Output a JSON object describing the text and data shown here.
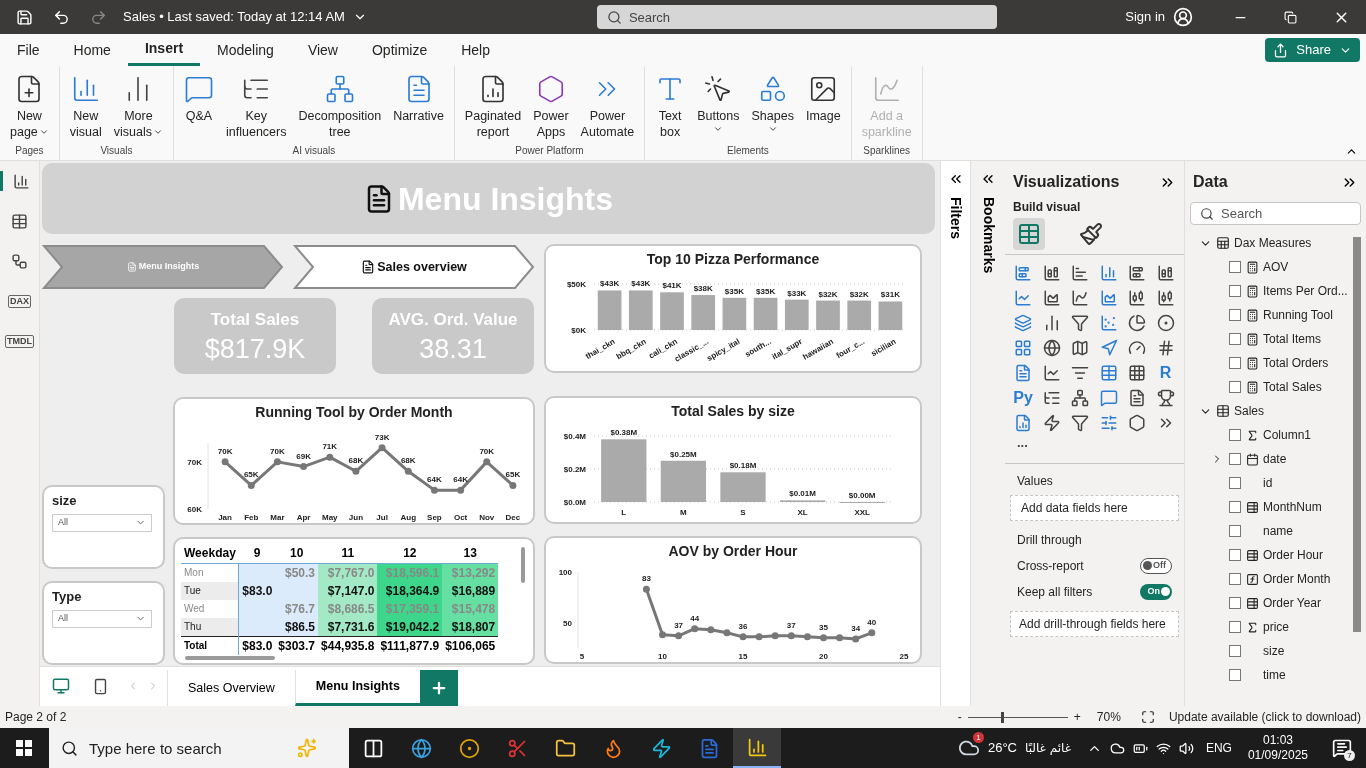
{
  "title_bar": {
    "document": "Sales",
    "separator": "•",
    "saved": "Last saved: Today at 12:14 AM",
    "search_placeholder": "Search",
    "sign_in": "Sign in"
  },
  "menu_tabs": [
    {
      "label": "File",
      "selected": false
    },
    {
      "label": "Home",
      "selected": false
    },
    {
      "label": "Insert",
      "selected": true
    },
    {
      "label": "Modeling",
      "selected": false
    },
    {
      "label": "View",
      "selected": false
    },
    {
      "label": "Optimize",
      "selected": false
    },
    {
      "label": "Help",
      "selected": false
    }
  ],
  "share": "Share",
  "ribbon_groups": [
    {
      "label": "Pages",
      "items": [
        {
          "kind": "new-page",
          "lines": [
            "New",
            "page"
          ],
          "dropdown": true,
          "disabled": false
        }
      ]
    },
    {
      "label": "Visuals",
      "items": [
        {
          "kind": "new-visual",
          "lines": [
            "New",
            "visual"
          ],
          "dropdown": false,
          "disabled": false
        },
        {
          "kind": "more-visuals",
          "lines": [
            "More",
            "visuals"
          ],
          "dropdown": true,
          "disabled": false
        }
      ]
    },
    {
      "label": "AI visuals",
      "items": [
        {
          "kind": "qa",
          "lines": [
            "Q&A"
          ],
          "dropdown": false,
          "disabled": false
        },
        {
          "kind": "key-influencers",
          "lines": [
            "Key",
            "influencers"
          ],
          "dropdown": false,
          "disabled": false
        },
        {
          "kind": "decomposition",
          "lines": [
            "Decomposition",
            "tree"
          ],
          "dropdown": false,
          "disabled": false
        },
        {
          "kind": "narrative",
          "lines": [
            "Narrative"
          ],
          "dropdown": false,
          "disabled": false
        }
      ]
    },
    {
      "label": "Power Platform",
      "items": [
        {
          "kind": "paginated",
          "lines": [
            "Paginated",
            "report"
          ],
          "dropdown": false,
          "disabled": false
        },
        {
          "kind": "power-apps",
          "lines": [
            "Power",
            "Apps"
          ],
          "dropdown": false,
          "disabled": false
        },
        {
          "kind": "power-automate",
          "lines": [
            "Power",
            "Automate"
          ],
          "dropdown": false,
          "disabled": false
        }
      ]
    },
    {
      "label": "Elements",
      "items": [
        {
          "kind": "text-box",
          "lines": [
            "Text",
            "box"
          ],
          "dropdown": false,
          "disabled": false
        },
        {
          "kind": "buttons",
          "lines": [
            "Buttons"
          ],
          "dropdown": true,
          "disabled": false
        },
        {
          "kind": "shapes",
          "lines": [
            "Shapes"
          ],
          "dropdown": true,
          "disabled": false
        },
        {
          "kind": "image",
          "lines": [
            "Image"
          ],
          "dropdown": false,
          "disabled": false
        }
      ]
    },
    {
      "label": "Sparklines",
      "items": [
        {
          "kind": "sparkline",
          "lines": [
            "Add a",
            "sparkline"
          ],
          "dropdown": false,
          "disabled": true
        }
      ]
    }
  ],
  "left_nav": [
    {
      "kind": "report",
      "selected": true
    },
    {
      "kind": "table",
      "selected": false
    },
    {
      "kind": "model",
      "selected": false
    },
    {
      "kind": "dax",
      "label": "DAX",
      "selected": false
    },
    {
      "kind": "tmdl",
      "label": "TMDL",
      "selected": false
    }
  ],
  "report": {
    "heading": "Menu Insights",
    "nav_buttons": [
      {
        "label": "Menu Insights",
        "selected": true
      },
      {
        "label": "Sales overview",
        "selected": false
      }
    ],
    "kpis": [
      {
        "label": "Total Sales",
        "value": "$817.9K"
      },
      {
        "label": "AVG. Ord. Value",
        "value": "38.31"
      }
    ],
    "slicers": [
      {
        "title": "size",
        "value": "All"
      },
      {
        "title": "Type",
        "value": "All"
      }
    ],
    "top10": {
      "chart_data": {
        "type": "bar",
        "title": "Top 10 Pizza Performance",
        "categories": [
          "thai_ckn",
          "bbq_ckn",
          "cali_ckn",
          "classic_...",
          "spicy_ital",
          "south...",
          "ital_supr",
          "hawaiian",
          "four_c...",
          "sicilian"
        ],
        "values": [
          43,
          43,
          41,
          38,
          35,
          35,
          33,
          32,
          32,
          31
        ],
        "ylim": [
          0,
          50
        ],
        "yticks": [
          {
            "value": 0,
            "label": "$0K"
          },
          {
            "value": 50,
            "label": "$50K"
          }
        ],
        "value_labels": [
          "$43K",
          "$43K",
          "$41K",
          "$38K",
          "$35K",
          "$35K",
          "$33K",
          "$32K",
          "$32K",
          "$31K"
        ]
      }
    },
    "running": {
      "chart_data": {
        "type": "line",
        "title": "Running Tool by Order Month",
        "categories": [
          "Jan",
          "Feb",
          "Mar",
          "Apr",
          "May",
          "Jun",
          "Jul",
          "Aug",
          "Sep",
          "Oct",
          "Nov",
          "Dec"
        ],
        "values": [
          70,
          65,
          70,
          69,
          71,
          68,
          73,
          68,
          64,
          64,
          70,
          65
        ],
        "marker": true,
        "ylim": [
          60,
          74
        ],
        "yticks": [
          {
            "value": 60,
            "label": "60K"
          },
          {
            "value": 70,
            "label": "70K"
          }
        ],
        "value_labels": [
          "70K",
          "65K",
          "70K",
          "69K",
          "71K",
          "68K",
          "73K",
          "68K",
          "64K",
          "64K",
          "70K",
          "65K"
        ]
      }
    },
    "by_size": {
      "chart_data": {
        "type": "bar",
        "title": "Total Sales by size",
        "categories": [
          "L",
          "M",
          "S",
          "XL",
          "XXL"
        ],
        "values": [
          0.38,
          0.25,
          0.18,
          0.01,
          0.0
        ],
        "ylim": [
          0,
          0.4
        ],
        "yticks": [
          {
            "value": 0,
            "label": "$0.0M"
          },
          {
            "value": 0.2,
            "label": "$0.2M"
          },
          {
            "value": 0.4,
            "label": "$0.4M"
          }
        ],
        "value_labels": [
          "$0.38M",
          "$0.25M",
          "$0.18M",
          "$0.01M",
          "$0.00M"
        ]
      }
    },
    "aov": {
      "chart_data": {
        "type": "line",
        "title": "AOV by Order Hour",
        "x": [
          9,
          10,
          11,
          12,
          13,
          14,
          15,
          16,
          17,
          18,
          19,
          20,
          21,
          22,
          23
        ],
        "values": [
          83,
          38,
          37,
          44,
          43,
          40,
          36,
          36,
          37,
          37,
          36,
          35,
          35,
          34,
          40
        ],
        "xlim": [
          5,
          25
        ],
        "ylim": [
          25,
          100
        ],
        "marker": true,
        "xticks": [
          5,
          10,
          15,
          20,
          25
        ],
        "yticks": [
          50,
          100
        ],
        "value_labels": [
          "83",
          null,
          "37",
          "44",
          null,
          null,
          "36",
          null,
          null,
          "37",
          null,
          "35",
          null,
          "34",
          "40"
        ]
      }
    },
    "matrix": {
      "corner": "Weekday",
      "columns": [
        {
          "label": "9",
          "color": "#dcebfb"
        },
        {
          "label": "10",
          "color": "#dcebfb"
        },
        {
          "label": "11",
          "color": "#a3e9c6"
        },
        {
          "label": "12",
          "color": "#3ed68a"
        },
        {
          "label": "13",
          "color": "#66dfa3"
        }
      ],
      "rows": [
        {
          "label": "Mon",
          "dimmed": true,
          "cells": [
            null,
            "$50.3",
            "$7,767.0",
            "$18,596.1",
            "$13,292"
          ]
        },
        {
          "label": "Tue",
          "dimmed": false,
          "cells": [
            "$83.0",
            null,
            "$7,147.0",
            "$18,364.9",
            "$16,889"
          ]
        },
        {
          "label": "Wed",
          "dimmed": true,
          "cells": [
            null,
            "$76.7",
            "$8,686.5",
            "$17,359.1",
            "$15,478"
          ]
        },
        {
          "label": "Thu",
          "dimmed": false,
          "cells": [
            null,
            "$86.5",
            "$7,731.6",
            "$19,042.2",
            "$18,807"
          ]
        }
      ],
      "total": {
        "label": "Total",
        "cells": [
          "$83.0",
          "$303.7",
          "$44,935.8",
          "$111,877.9",
          "$106,065"
        ]
      }
    }
  },
  "panes": {
    "filters_label": "Filters",
    "bookmarks_label": "Bookmarks"
  },
  "visualizations": {
    "title": "Visualizations",
    "build_label": "Build visual",
    "build_tabs": [
      {
        "kind": "build",
        "selected": true
      },
      {
        "kind": "format",
        "selected": false
      }
    ],
    "script_labels": [
      "R",
      "Py"
    ],
    "more": "...",
    "values_label": "Values",
    "values_placeholder": "Add data fields here",
    "drill_title": "Drill through",
    "toggles": [
      {
        "label": "Cross-report",
        "on": false,
        "state_text": "Off"
      },
      {
        "label": "Keep all filters",
        "on": true,
        "state_text": "On"
      }
    ],
    "drill_placeholder": "Add drill-through fields here"
  },
  "data_pane": {
    "title": "Data",
    "search_placeholder": "Search",
    "tables": [
      {
        "name": "Dax Measures",
        "kind": "measures",
        "expanded": true,
        "children": [
          {
            "name": "AOV",
            "kind": "measure",
            "checked": false
          },
          {
            "name": "Items Per Ord...",
            "kind": "measure",
            "checked": false
          },
          {
            "name": "Running Tool",
            "kind": "measure",
            "checked": false
          },
          {
            "name": "Total Items",
            "kind": "measure",
            "checked": false
          },
          {
            "name": "Total Orders",
            "kind": "measure",
            "checked": false
          },
          {
            "name": "Total Sales",
            "kind": "measure",
            "checked": false
          }
        ]
      },
      {
        "name": "Sales",
        "kind": "table",
        "expanded": true,
        "children": [
          {
            "name": "Column1",
            "kind": "sum",
            "checked": false
          },
          {
            "name": "date",
            "kind": "date",
            "checked": false,
            "expanded": false
          },
          {
            "name": "id",
            "kind": "plain",
            "checked": false
          },
          {
            "name": "MonthNum",
            "kind": "calc",
            "checked": false
          },
          {
            "name": "name",
            "kind": "plain",
            "checked": false
          },
          {
            "name": "Order Hour",
            "kind": "calc",
            "checked": false
          },
          {
            "name": "Order Month",
            "kind": "fx",
            "checked": false
          },
          {
            "name": "Order Year",
            "kind": "calc",
            "checked": false
          },
          {
            "name": "price",
            "kind": "sum",
            "checked": false
          },
          {
            "name": "size",
            "kind": "plain",
            "checked": false
          },
          {
            "name": "time",
            "kind": "plain",
            "checked": false
          }
        ]
      }
    ]
  },
  "page_tabs": [
    {
      "label": "Sales Overview",
      "selected": false
    },
    {
      "label": "Menu Insights",
      "selected": true
    }
  ],
  "status_bar": {
    "page": "Page 2 of 2",
    "zoom_out": "-",
    "zoom_in": "+",
    "level": 0.33,
    "zoom": "70%",
    "update": "Update available (click to download)"
  },
  "taskbar": {
    "search_placeholder": "Type here to search",
    "weather_badge": "1",
    "temperature": "26°C",
    "weather": "غائم غالبًا",
    "language": "ENG",
    "time": "01:03",
    "date": "01/09/2025",
    "notifications": "7"
  }
}
